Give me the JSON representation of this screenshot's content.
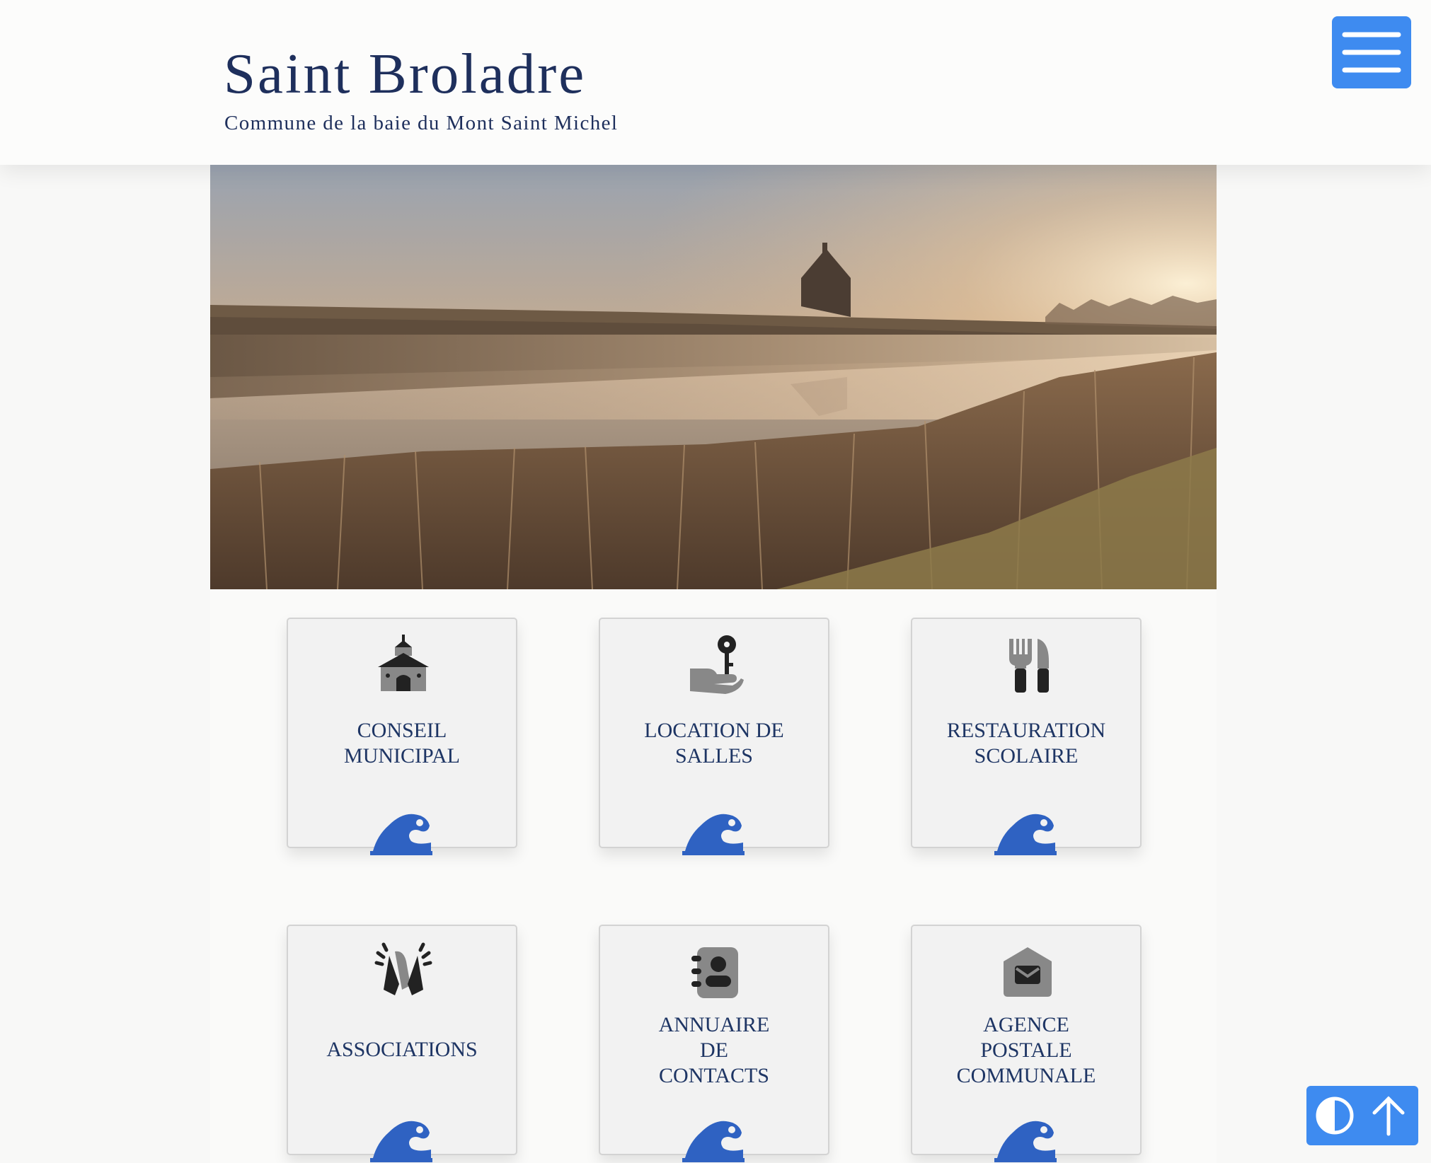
{
  "site": {
    "title": "Saint Broladre",
    "subtitle": "Commune de la baie du Mont Saint Michel"
  },
  "colors": {
    "title": "#1e2f5c",
    "accent": "#3e8bf0",
    "wave": "#2f62c2",
    "tile_bg": "#f2f2f2"
  },
  "header": {
    "menu_icon": "hamburger-menu-icon"
  },
  "hero": {
    "image": "landscape-photo-chapel-misty-river-reeds-sunrise"
  },
  "tiles": [
    {
      "label": "CONSEIL\nMUNICIPAL",
      "icon": "town-hall-icon",
      "footer_icon": "wave-icon"
    },
    {
      "label": "LOCATION DE\nSALLES",
      "icon": "hand-key-icon",
      "footer_icon": "wave-icon"
    },
    {
      "label": "RESTAURATION\nSCOLAIRE",
      "icon": "fork-knife-icon",
      "footer_icon": "wave-icon"
    },
    {
      "label": "ASSOCIATIONS",
      "icon": "clapping-hands-icon",
      "footer_icon": "wave-icon"
    },
    {
      "label": "ANNUAIRE\nDE\nCONTACTS",
      "icon": "contact-book-icon",
      "footer_icon": "wave-icon"
    },
    {
      "label": "AGENCE\nPOSTALE\nCOMMUNALE",
      "icon": "mail-envelope-icon",
      "footer_icon": "wave-icon"
    }
  ],
  "floating_buttons": [
    {
      "icon": "contrast-toggle-icon"
    },
    {
      "icon": "arrow-up-icon"
    }
  ]
}
